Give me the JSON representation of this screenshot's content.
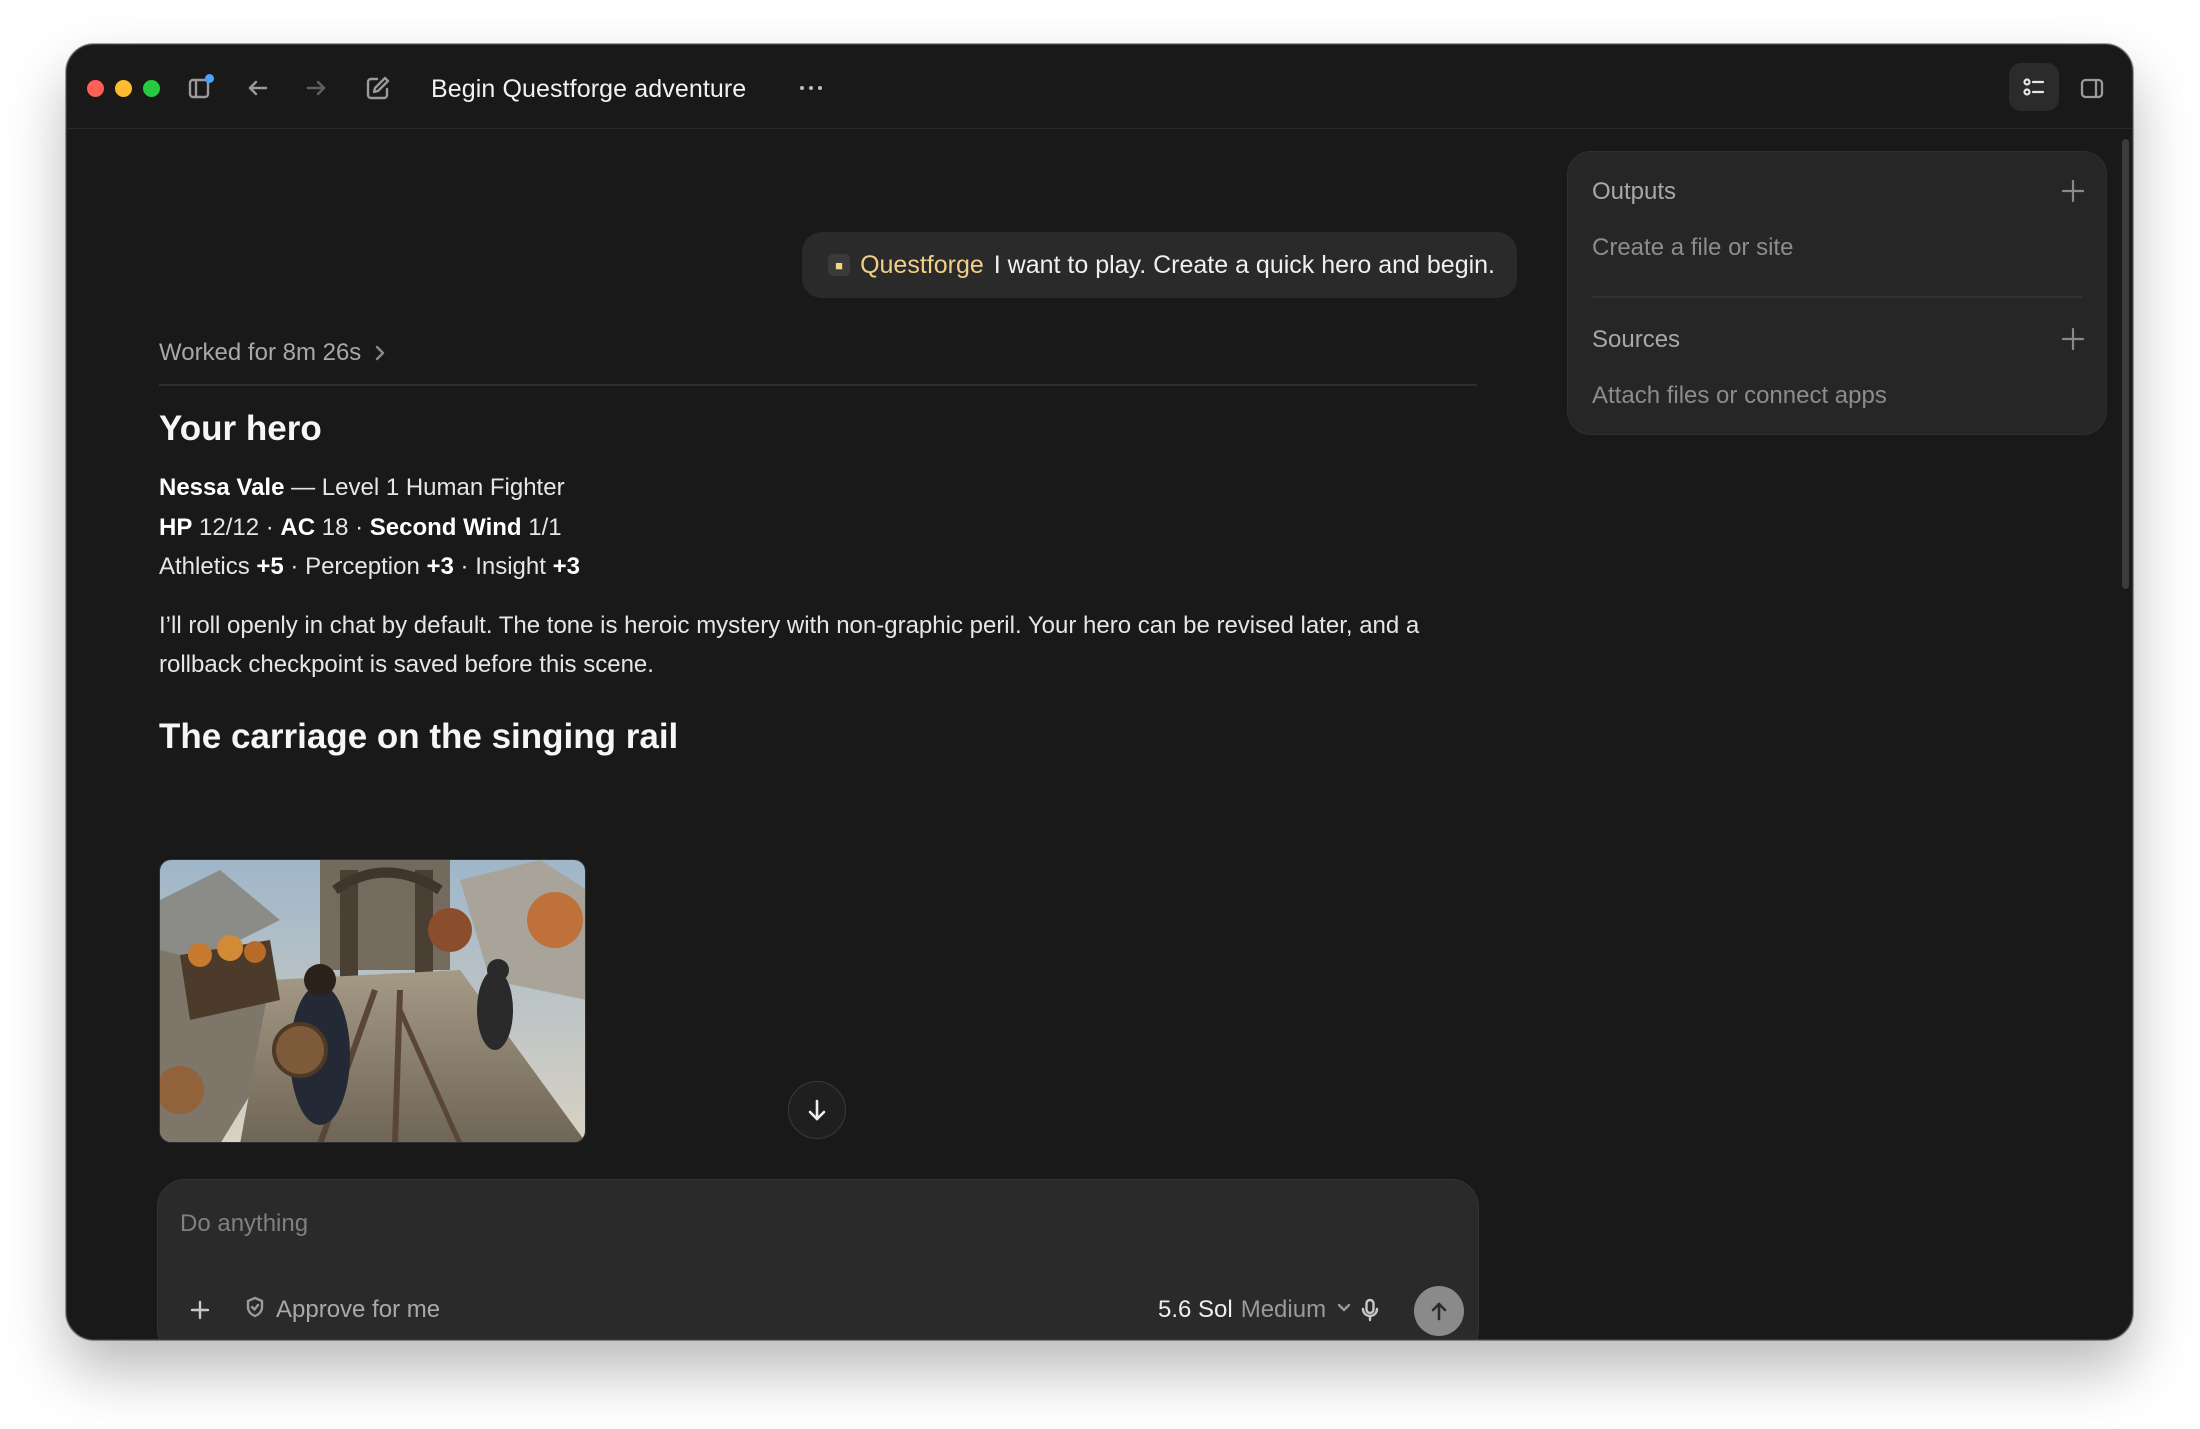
{
  "window": {
    "title": "Begin Questforge adventure"
  },
  "toolbar": {
    "icons": [
      "sidebar-icon",
      "back-arrow-icon",
      "forward-arrow-icon",
      "new-chat-icon",
      "more-icon",
      "checklist-icon",
      "panel-icon"
    ]
  },
  "conversation": {
    "user_message": {
      "mention": "Questforge",
      "text": "I want to play. Create a quick hero and begin."
    },
    "worked_label": "Worked for 8m 26s",
    "hero_heading": "Your hero",
    "hero_line1": {
      "name": "Nessa Vale",
      "rest": " — Level 1 Human Fighter"
    },
    "hero_line2": {
      "hp_label": "HP",
      "hp_value": " 12/12 · ",
      "ac_label": "AC",
      "ac_value": " 18 · ",
      "sw_label": "Second Wind",
      "sw_value": " 1/1"
    },
    "hero_line3": {
      "ath_label": "Athletics ",
      "ath_value": "+5",
      "per_label": " · Perception ",
      "per_value": "+3",
      "ins_label": " · Insight ",
      "ins_value": "+3"
    },
    "description": "I’ll roll openly in chat by default. The tone is heroic mystery with non-graphic peril. Your hero can be revised later, and a rollback checkpoint is saved before this scene.",
    "scene_heading": "The carriage on the singing rail"
  },
  "composer": {
    "placeholder": "Do anything",
    "approve_label": "Approve for me",
    "model_name": "5.6 Sol",
    "model_level": "Medium"
  },
  "side_panel": {
    "outputs_title": "Outputs",
    "outputs_sub": "Create a file or site",
    "sources_title": "Sources",
    "sources_sub": "Attach files or connect apps"
  },
  "colors": {
    "background": "#191919",
    "surface": "#2a2a2a",
    "mention": "#f2cf86",
    "text": "#ececec",
    "muted": "#a8a8a8"
  }
}
